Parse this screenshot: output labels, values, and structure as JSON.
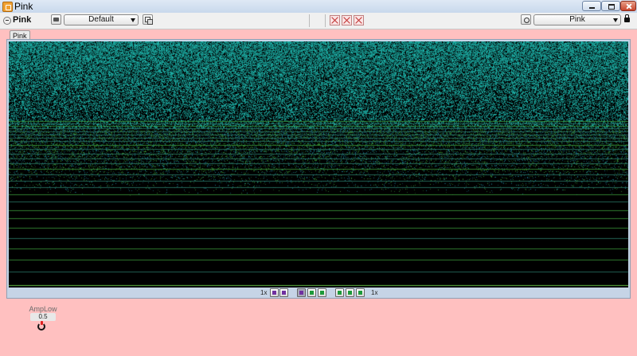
{
  "window": {
    "title": "Pink"
  },
  "toolbar": {
    "plugin_name": "Pink",
    "preset": "Default",
    "program": "Pink"
  },
  "panel": {
    "tab_label": "Pink"
  },
  "controls": {
    "zoom_x_label": "1x",
    "zoom_y_label": "1x"
  },
  "knob": {
    "label": "AmpLow",
    "value": "0.5"
  },
  "colors": {
    "background": "#ffc0c0",
    "spectrogram_high": "#2fc7c0",
    "spectrogram_mid": "#3a9a3a",
    "spectrogram_bg": "#000000"
  }
}
